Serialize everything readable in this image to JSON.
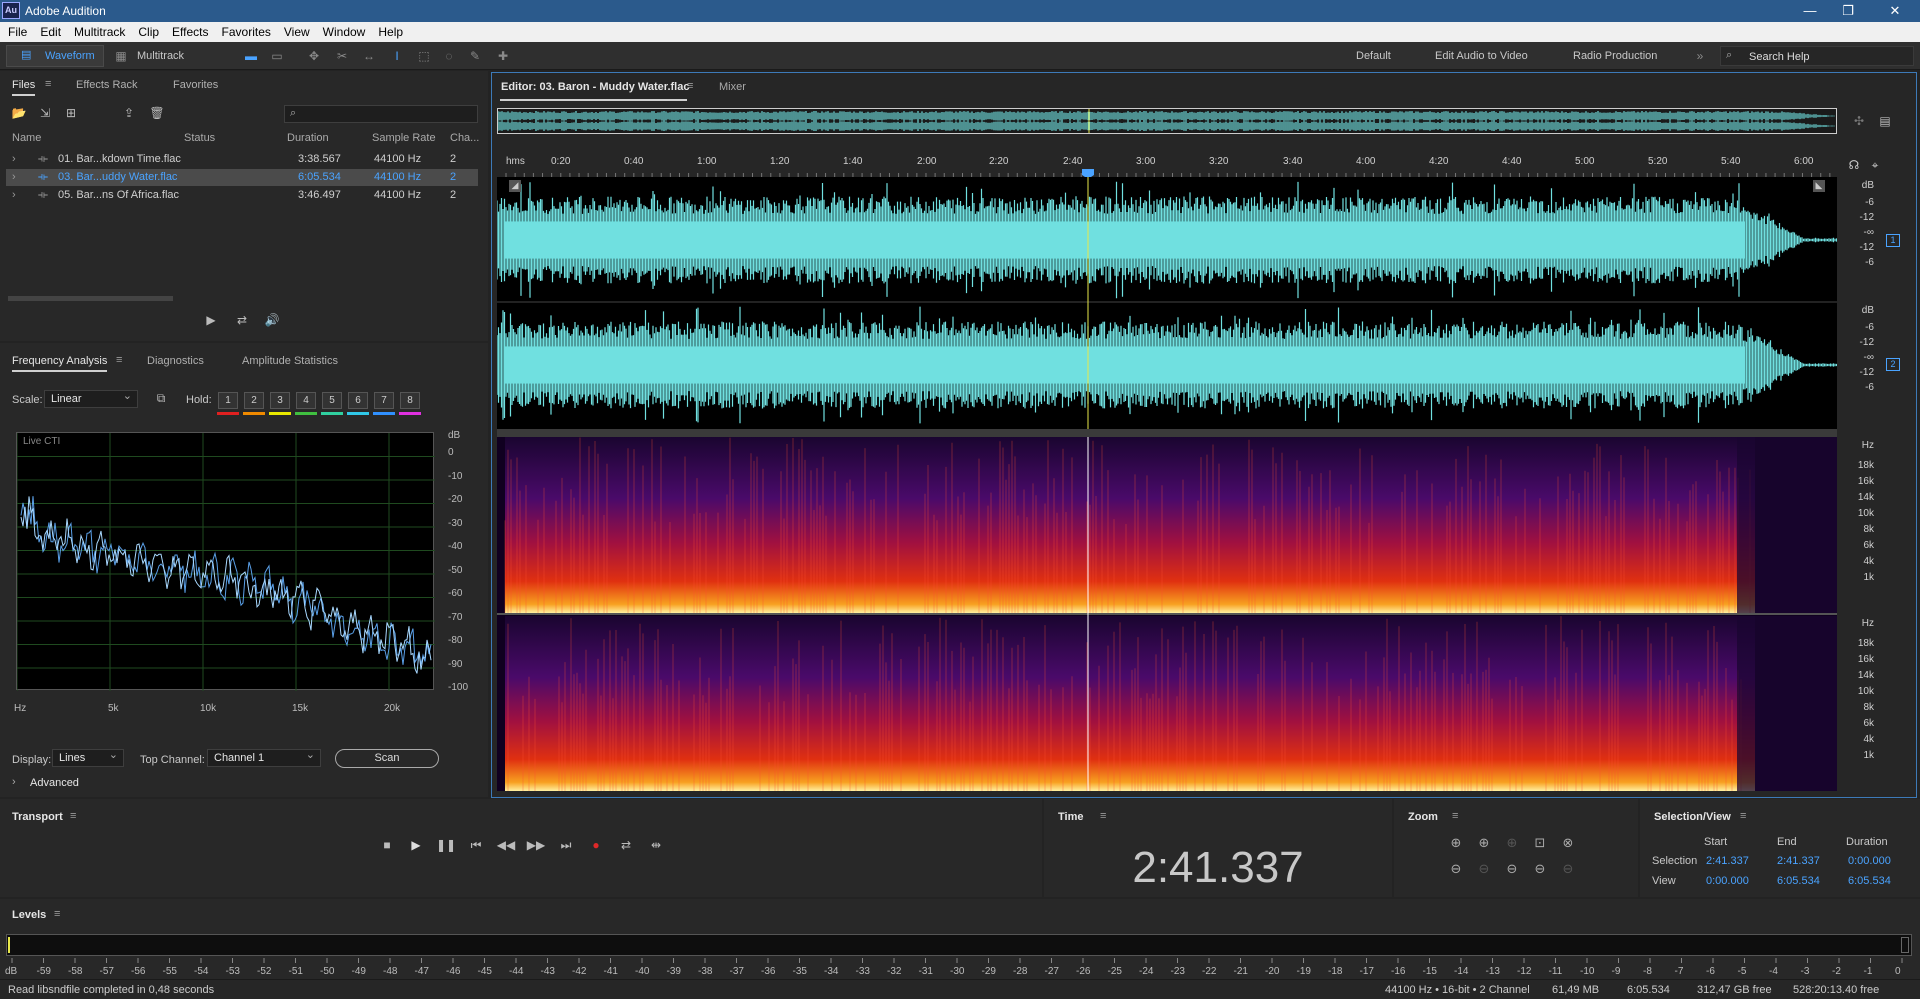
{
  "window": {
    "title": "Adobe Audition",
    "logo": "Au"
  },
  "menu": [
    "File",
    "Edit",
    "Multitrack",
    "Clip",
    "Effects",
    "Favorites",
    "View",
    "Window",
    "Help"
  ],
  "toolbar": {
    "waveform": "Waveform",
    "multitrack": "Multitrack",
    "workspaces": [
      "Default",
      "Edit Audio to Video",
      "Radio Production"
    ],
    "search_placeholder": "Search Help"
  },
  "files": {
    "tabs": [
      "Files",
      "Effects Rack",
      "Favorites"
    ],
    "columns": [
      "Name",
      "Status",
      "Duration",
      "Sample Rate",
      "Cha..."
    ],
    "rows": [
      {
        "name": "01. Bar...kdown Time.flac",
        "duration": "3:38.567",
        "rate": "44100 Hz",
        "ch": "2",
        "selected": false
      },
      {
        "name": "03. Bar...uddy Water.flac",
        "duration": "6:05.534",
        "rate": "44100 Hz",
        "ch": "2",
        "selected": true
      },
      {
        "name": "05. Bar...ns Of Africa.flac",
        "duration": "3:46.497",
        "rate": "44100 Hz",
        "ch": "2",
        "selected": false
      }
    ]
  },
  "freq": {
    "tabs": [
      "Frequency Analysis",
      "Diagnostics",
      "Amplitude Statistics"
    ],
    "scale_label": "Scale:",
    "scale_value": "Linear",
    "hold_label": "Hold:",
    "hold_buttons": [
      "1",
      "2",
      "3",
      "4",
      "5",
      "6",
      "7",
      "8"
    ],
    "hold_colors": [
      "#e02020",
      "#f08a00",
      "#e8e800",
      "#40c040",
      "#30d0a0",
      "#30c8e8",
      "#3090ff",
      "#e030e0"
    ],
    "live_label": "Live CTI",
    "db_labels": [
      "dB",
      "0",
      "-10",
      "-20",
      "-30",
      "-40",
      "-50",
      "-60",
      "-70",
      "-80",
      "-90",
      "-100"
    ],
    "x_labels": [
      "Hz",
      "5k",
      "10k",
      "15k",
      "20k"
    ],
    "display_label": "Display:",
    "display_value": "Lines",
    "top_channel_label": "Top Channel:",
    "top_channel_value": "Channel 1",
    "scan": "Scan",
    "advanced": "Advanced"
  },
  "editor": {
    "tab": "Editor: 03. Baron - Muddy Water.flac",
    "mixer": "Mixer",
    "ruler": [
      "hms",
      "0:20",
      "0:40",
      "1:00",
      "1:20",
      "1:40",
      "2:00",
      "2:20",
      "2:40",
      "3:00",
      "3:20",
      "3:40",
      "4:00",
      "4:20",
      "4:40",
      "5:00",
      "5:20",
      "5:40",
      "6:00"
    ],
    "db_scale": [
      "dB",
      "-6",
      "-12",
      "-∞",
      "-12",
      "-6"
    ],
    "hz_scale": [
      "Hz",
      "18k",
      "16k",
      "14k",
      "10k",
      "8k",
      "6k",
      "4k",
      "1k"
    ],
    "channels": [
      "1",
      "2"
    ],
    "waveform_color": "#70e0e0",
    "playhead_color": "#e8e84a"
  },
  "transport": {
    "title": "Transport"
  },
  "time": {
    "title": "Time",
    "value": "2:41.337"
  },
  "zoom": {
    "title": "Zoom"
  },
  "selview": {
    "title": "Selection/View",
    "headers": [
      "Start",
      "End",
      "Duration"
    ],
    "selection": {
      "label": "Selection",
      "start": "2:41.337",
      "end": "2:41.337",
      "duration": "0:00.000"
    },
    "view": {
      "label": "View",
      "start": "0:00.000",
      "end": "6:05.534",
      "duration": "6:05.534"
    }
  },
  "levels": {
    "title": "Levels",
    "scale": [
      "dB",
      "-59",
      "-58",
      "-57",
      "-56",
      "-55",
      "-54",
      "-53",
      "-52",
      "-51",
      "-50",
      "-49",
      "-48",
      "-47",
      "-46",
      "-45",
      "-44",
      "-43",
      "-42",
      "-41",
      "-40",
      "-39",
      "-38",
      "-37",
      "-36",
      "-35",
      "-34",
      "-33",
      "-32",
      "-31",
      "-30",
      "-29",
      "-28",
      "-27",
      "-26",
      "-25",
      "-24",
      "-23",
      "-22",
      "-21",
      "-20",
      "-19",
      "-18",
      "-17",
      "-16",
      "-15",
      "-14",
      "-13",
      "-12",
      "-11",
      "-10",
      "-9",
      "-8",
      "-7",
      "-6",
      "-5",
      "-4",
      "-3",
      "-2",
      "-1",
      "0"
    ]
  },
  "status": {
    "message": "Read libsndfile completed in 0,48 seconds",
    "format": "44100 Hz • 16-bit • 2 Channel",
    "size": "61,49 MB",
    "duration": "6:05.534",
    "free": "312,47 GB free",
    "free_time": "528:20:13.40 free"
  }
}
